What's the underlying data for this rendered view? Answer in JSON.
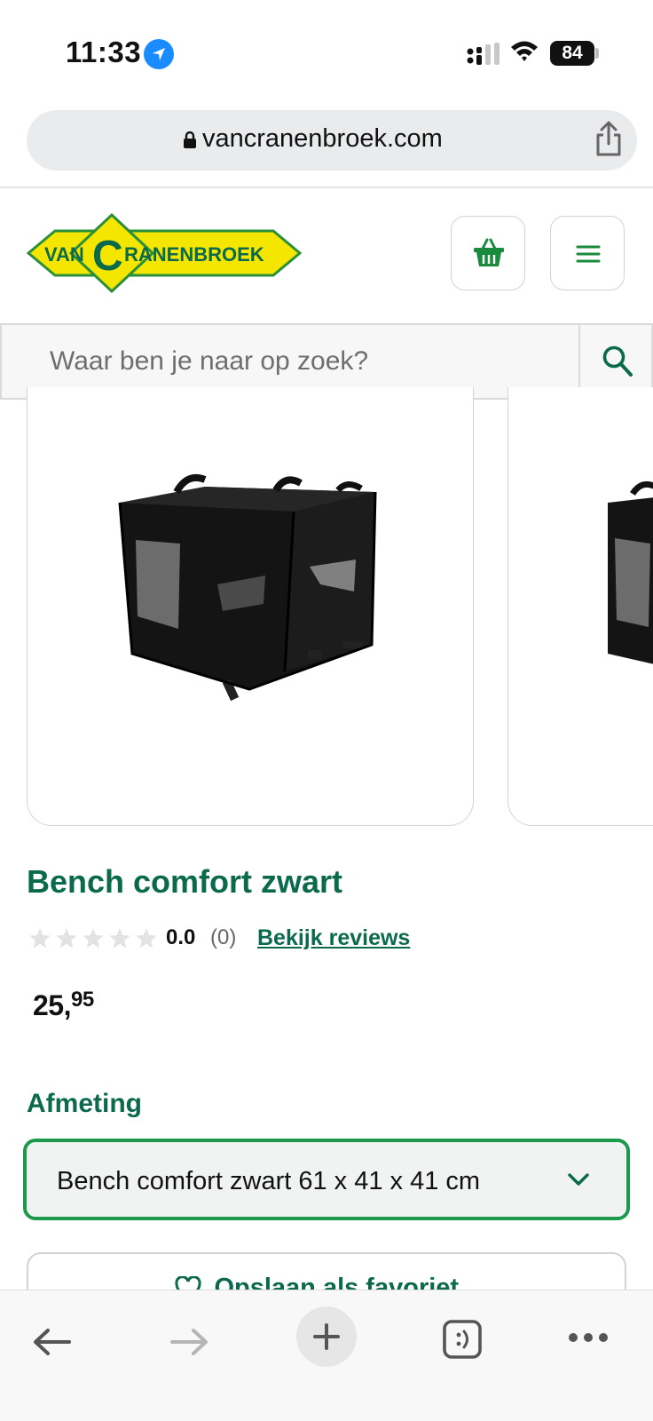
{
  "status_bar": {
    "time": "11:33",
    "battery": "84"
  },
  "browser": {
    "url": "vancranenbroek.com"
  },
  "header": {
    "logo_text_left": "VAN",
    "logo_text_c": "C",
    "logo_text_right": "RANENBROEK",
    "brand_green": "#0b6a4b",
    "brand_yellow": "#f5e600"
  },
  "search": {
    "placeholder": "Waar ben je naar op zoek?"
  },
  "product": {
    "title": "Bench comfort zwart",
    "rating_value": "0.0",
    "rating_count": "(0)",
    "reviews_link": "Bekijk reviews",
    "price_main": "25,",
    "price_cents": "95",
    "stars_filled": 0,
    "stars_total": 5
  },
  "options": {
    "size_label": "Afmeting",
    "size_selected": "Bench comfort zwart 61 x 41 x 41 cm"
  },
  "actions": {
    "favorite_label": "Opslaan als favoriet"
  },
  "icons": {
    "location": "location-arrow-icon",
    "basket": "basket-icon",
    "menu": "hamburger-menu-icon",
    "search": "search-icon",
    "share": "share-icon",
    "chevron": "chevron-down-icon",
    "heart": "heart-icon"
  }
}
